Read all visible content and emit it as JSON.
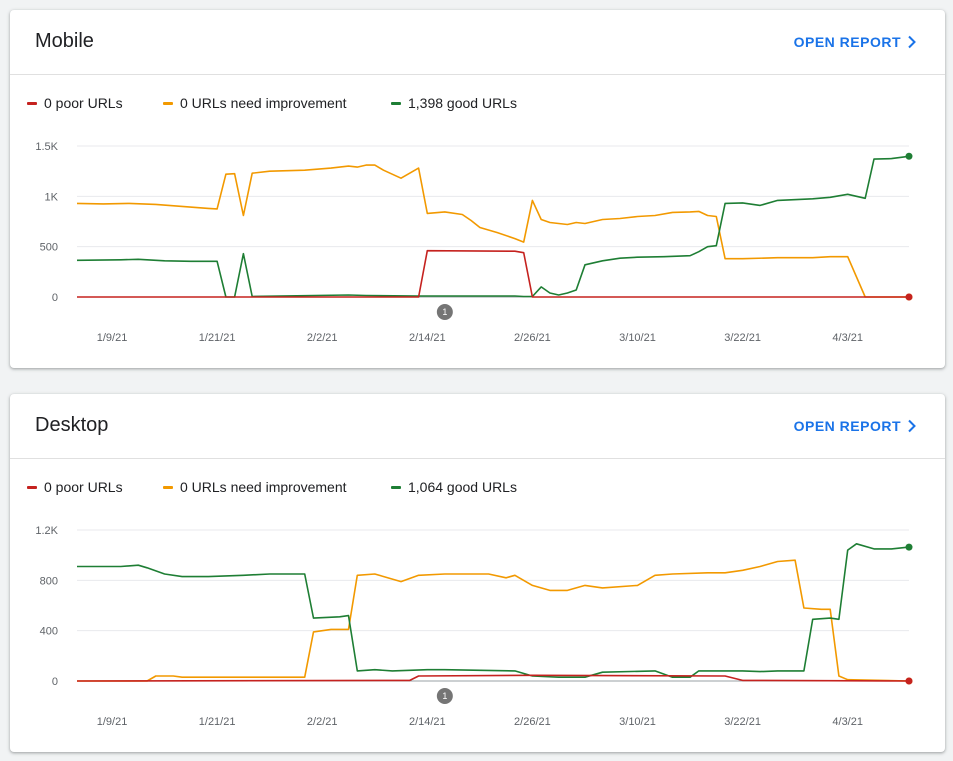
{
  "colors": {
    "poor": "#c5221f",
    "needs_improvement": "#f29900",
    "good": "#1e7e34",
    "link": "#1a73e8"
  },
  "cards": [
    {
      "title": "Mobile",
      "open_report_label": "OPEN REPORT",
      "legend": [
        {
          "label": "0 poor URLs",
          "series": "poor"
        },
        {
          "label": "0 URLs need improvement",
          "series": "needs_improvement"
        },
        {
          "label": "1,398 good URLs",
          "series": "good"
        }
      ]
    },
    {
      "title": "Desktop",
      "open_report_label": "OPEN REPORT",
      "legend": [
        {
          "label": "0 poor URLs",
          "series": "poor"
        },
        {
          "label": "0 URLs need improvement",
          "series": "needs_improvement"
        },
        {
          "label": "1,064 good URLs",
          "series": "good"
        }
      ]
    }
  ],
  "chart_data": [
    {
      "type": "line",
      "title": "Mobile",
      "x_range": [
        "1/5/21",
        "4/10/21"
      ],
      "xticks": [
        "1/9/21",
        "1/21/21",
        "2/2/21",
        "2/14/21",
        "2/26/21",
        "3/10/21",
        "3/22/21",
        "4/3/21"
      ],
      "ylim": [
        0,
        1500
      ],
      "yticks": [
        0,
        500,
        1000,
        1500
      ],
      "ytick_labels": [
        "0",
        "500",
        "1K",
        "1.5K"
      ],
      "grid": true,
      "annotation": {
        "date": "2/16/21",
        "label": "1"
      },
      "series": [
        {
          "name": "0 poor URLs",
          "key": "poor",
          "points": [
            [
              "1/5/21",
              0
            ],
            [
              "2/13/21",
              0
            ],
            [
              "2/14/21",
              460
            ],
            [
              "2/24/21",
              455
            ],
            [
              "2/25/21",
              440
            ],
            [
              "2/26/21",
              0
            ],
            [
              "4/10/21",
              0
            ]
          ]
        },
        {
          "name": "0 URLs need improvement",
          "key": "needs_improvement",
          "points": [
            [
              "1/5/21",
              930
            ],
            [
              "1/8/21",
              925
            ],
            [
              "1/11/21",
              930
            ],
            [
              "1/14/21",
              920
            ],
            [
              "1/17/21",
              900
            ],
            [
              "1/20/21",
              880
            ],
            [
              "1/21/21",
              875
            ],
            [
              "1/22/21",
              1220
            ],
            [
              "1/23/21",
              1225
            ],
            [
              "1/24/21",
              810
            ],
            [
              "1/25/21",
              1230
            ],
            [
              "1/27/21",
              1250
            ],
            [
              "1/31/21",
              1260
            ],
            [
              "2/3/21",
              1280
            ],
            [
              "2/5/21",
              1300
            ],
            [
              "2/6/21",
              1290
            ],
            [
              "2/7/21",
              1310
            ],
            [
              "2/8/21",
              1310
            ],
            [
              "2/9/21",
              1260
            ],
            [
              "2/11/21",
              1180
            ],
            [
              "2/13/21",
              1280
            ],
            [
              "2/14/21",
              830
            ],
            [
              "2/16/21",
              845
            ],
            [
              "2/18/21",
              820
            ],
            [
              "2/19/21",
              760
            ],
            [
              "2/20/21",
              690
            ],
            [
              "2/22/21",
              640
            ],
            [
              "2/24/21",
              580
            ],
            [
              "2/25/21",
              545
            ],
            [
              "2/26/21",
              960
            ],
            [
              "2/27/21",
              770
            ],
            [
              "2/28/21",
              740
            ],
            [
              "3/2/21",
              720
            ],
            [
              "3/3/21",
              740
            ],
            [
              "3/4/21",
              730
            ],
            [
              "3/6/21",
              770
            ],
            [
              "3/8/21",
              780
            ],
            [
              "3/10/21",
              800
            ],
            [
              "3/12/21",
              810
            ],
            [
              "3/14/21",
              840
            ],
            [
              "3/16/21",
              845
            ],
            [
              "3/17/21",
              850
            ],
            [
              "3/18/21",
              810
            ],
            [
              "3/19/21",
              800
            ],
            [
              "3/20/21",
              380
            ],
            [
              "3/22/21",
              380
            ],
            [
              "3/26/21",
              390
            ],
            [
              "3/30/21",
              390
            ],
            [
              "4/1/21",
              400
            ],
            [
              "4/3/21",
              400
            ],
            [
              "4/5/21",
              0
            ],
            [
              "4/10/21",
              0
            ]
          ]
        },
        {
          "name": "1,398 good URLs",
          "key": "good",
          "points": [
            [
              "1/5/21",
              365
            ],
            [
              "1/10/21",
              370
            ],
            [
              "1/12/21",
              375
            ],
            [
              "1/15/21",
              360
            ],
            [
              "1/18/21",
              355
            ],
            [
              "1/21/21",
              355
            ],
            [
              "1/22/21",
              0
            ],
            [
              "1/23/21",
              0
            ],
            [
              "1/24/21",
              430
            ],
            [
              "1/25/21",
              5
            ],
            [
              "2/5/21",
              20
            ],
            [
              "2/7/21",
              15
            ],
            [
              "2/13/21",
              10
            ],
            [
              "2/24/21",
              10
            ],
            [
              "2/25/21",
              5
            ],
            [
              "2/26/21",
              5
            ],
            [
              "2/27/21",
              100
            ],
            [
              "2/28/21",
              40
            ],
            [
              "3/1/21",
              20
            ],
            [
              "3/2/21",
              40
            ],
            [
              "3/3/21",
              70
            ],
            [
              "3/4/21",
              320
            ],
            [
              "3/6/21",
              360
            ],
            [
              "3/8/21",
              385
            ],
            [
              "3/10/21",
              395
            ],
            [
              "3/13/21",
              400
            ],
            [
              "3/16/21",
              410
            ],
            [
              "3/17/21",
              450
            ],
            [
              "3/18/21",
              500
            ],
            [
              "3/19/21",
              510
            ],
            [
              "3/20/21",
              930
            ],
            [
              "3/22/21",
              935
            ],
            [
              "3/24/21",
              910
            ],
            [
              "3/26/21",
              960
            ],
            [
              "3/30/21",
              975
            ],
            [
              "4/1/21",
              990
            ],
            [
              "4/3/21",
              1020
            ],
            [
              "4/5/21",
              980
            ],
            [
              "4/6/21",
              1370
            ],
            [
              "4/8/21",
              1375
            ],
            [
              "4/10/21",
              1398
            ]
          ]
        }
      ]
    },
    {
      "type": "line",
      "title": "Desktop",
      "x_range": [
        "1/5/21",
        "4/10/21"
      ],
      "xticks": [
        "1/9/21",
        "1/21/21",
        "2/2/21",
        "2/14/21",
        "2/26/21",
        "3/10/21",
        "3/22/21",
        "4/3/21"
      ],
      "ylim": [
        0,
        1200
      ],
      "yticks": [
        0,
        400,
        800,
        1200
      ],
      "ytick_labels": [
        "0",
        "400",
        "800",
        "1.2K"
      ],
      "grid": true,
      "annotation": {
        "date": "2/16/21",
        "label": "1"
      },
      "series": [
        {
          "name": "0 poor URLs",
          "key": "poor",
          "points": [
            [
              "1/5/21",
              0
            ],
            [
              "2/12/21",
              5
            ],
            [
              "2/13/21",
              40
            ],
            [
              "2/26/21",
              45
            ],
            [
              "3/20/21",
              40
            ],
            [
              "3/22/21",
              5
            ],
            [
              "4/10/21",
              0
            ]
          ]
        },
        {
          "name": "0 URLs need improvement",
          "key": "needs_improvement",
          "points": [
            [
              "1/5/21",
              0
            ],
            [
              "1/13/21",
              0
            ],
            [
              "1/14/21",
              40
            ],
            [
              "1/16/21",
              40
            ],
            [
              "1/17/21",
              30
            ],
            [
              "1/31/21",
              30
            ],
            [
              "2/1/21",
              390
            ],
            [
              "2/3/21",
              410
            ],
            [
              "2/5/21",
              410
            ],
            [
              "2/6/21",
              840
            ],
            [
              "2/8/21",
              850
            ],
            [
              "2/11/21",
              790
            ],
            [
              "2/13/21",
              840
            ],
            [
              "2/16/21",
              850
            ],
            [
              "2/21/21",
              850
            ],
            [
              "2/23/21",
              820
            ],
            [
              "2/24/21",
              840
            ],
            [
              "2/26/21",
              760
            ],
            [
              "2/28/21",
              720
            ],
            [
              "3/2/21",
              720
            ],
            [
              "3/4/21",
              760
            ],
            [
              "3/6/21",
              740
            ],
            [
              "3/10/21",
              760
            ],
            [
              "3/12/21",
              840
            ],
            [
              "3/14/21",
              850
            ],
            [
              "3/18/21",
              860
            ],
            [
              "3/20/21",
              860
            ],
            [
              "3/22/21",
              880
            ],
            [
              "3/24/21",
              910
            ],
            [
              "3/26/21",
              950
            ],
            [
              "3/28/21",
              960
            ],
            [
              "3/29/21",
              580
            ],
            [
              "3/31/21",
              570
            ],
            [
              "4/1/21",
              570
            ],
            [
              "4/2/21",
              40
            ],
            [
              "4/3/21",
              10
            ],
            [
              "4/10/21",
              0
            ]
          ]
        },
        {
          "name": "1,064 good URLs",
          "key": "good",
          "points": [
            [
              "1/5/21",
              910
            ],
            [
              "1/10/21",
              910
            ],
            [
              "1/12/21",
              920
            ],
            [
              "1/13/21",
              900
            ],
            [
              "1/15/21",
              850
            ],
            [
              "1/17/21",
              830
            ],
            [
              "1/20/21",
              830
            ],
            [
              "1/24/21",
              840
            ],
            [
              "1/27/21",
              850
            ],
            [
              "1/31/21",
              850
            ],
            [
              "2/1/21",
              500
            ],
            [
              "2/4/21",
              510
            ],
            [
              "2/5/21",
              520
            ],
            [
              "2/6/21",
              80
            ],
            [
              "2/8/21",
              90
            ],
            [
              "2/10/21",
              80
            ],
            [
              "2/12/21",
              85
            ],
            [
              "2/14/21",
              90
            ],
            [
              "2/16/21",
              90
            ],
            [
              "2/24/21",
              80
            ],
            [
              "2/26/21",
              40
            ],
            [
              "3/1/21",
              30
            ],
            [
              "3/4/21",
              30
            ],
            [
              "3/6/21",
              70
            ],
            [
              "3/12/21",
              80
            ],
            [
              "3/14/21",
              30
            ],
            [
              "3/16/21",
              30
            ],
            [
              "3/17/21",
              80
            ],
            [
              "3/22/21",
              80
            ],
            [
              "3/24/21",
              75
            ],
            [
              "3/26/21",
              80
            ],
            [
              "3/29/21",
              80
            ],
            [
              "3/30/21",
              490
            ],
            [
              "4/1/21",
              500
            ],
            [
              "4/2/21",
              490
            ],
            [
              "4/3/21",
              1040
            ],
            [
              "4/4/21",
              1090
            ],
            [
              "4/6/21",
              1050
            ],
            [
              "4/8/21",
              1050
            ],
            [
              "4/10/21",
              1064
            ]
          ]
        }
      ]
    }
  ]
}
